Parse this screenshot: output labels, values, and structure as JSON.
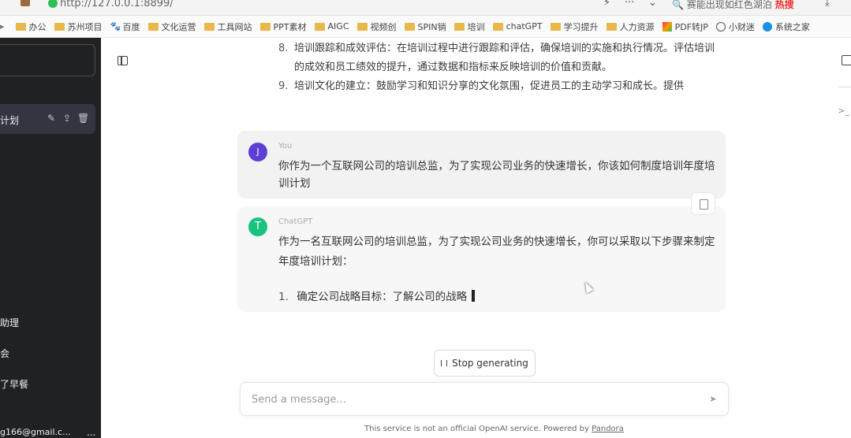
{
  "browser": {
    "url": "http://127.0.0.1:8899/",
    "search_text": "赛能出现如红色湖泊",
    "search_hot": "热搜"
  },
  "bookmarks": [
    {
      "label": "办公",
      "icon": "folder-icon"
    },
    {
      "label": "苏州项目",
      "icon": "folder-icon"
    },
    {
      "label": "百度",
      "icon": "paw-icon"
    },
    {
      "label": "文化运营",
      "icon": "folder-icon"
    },
    {
      "label": "工具网站",
      "icon": "folder-icon"
    },
    {
      "label": "PPT素材",
      "icon": "folder-icon"
    },
    {
      "label": "AIGC",
      "icon": "folder-icon"
    },
    {
      "label": "视频创",
      "icon": "folder-icon"
    },
    {
      "label": "SPIN销",
      "icon": "folder-icon"
    },
    {
      "label": "培训",
      "icon": "folder-icon"
    },
    {
      "label": "chatGPT",
      "icon": "folder-icon"
    },
    {
      "label": "学习提升",
      "icon": "folder-icon"
    },
    {
      "label": "人力资源",
      "icon": "folder-icon"
    },
    {
      "label": "PDF转JP",
      "icon": "pdf-icon"
    },
    {
      "label": "小财迷",
      "icon": "globe-icon"
    },
    {
      "label": "系统之家",
      "icon": "windows-icon"
    }
  ],
  "sidebar": {
    "conversation_label": "计划",
    "menu": [
      "助理",
      "会",
      "了早餐"
    ],
    "account_email": "g166@gmail.c...",
    "account_more": "..."
  },
  "previous_list": [
    {
      "num": "8.",
      "text": "培训跟踪和成效评估：在培训过程中进行跟踪和评估，确保培训的实施和执行情况。评估培训的成效和员工绩效的提升，通过数据和指标来反映培训的价值和贡献。"
    },
    {
      "num": "9.",
      "text": "培训文化的建立：鼓励学习和知识分享的文化氛围，促进员工的主动学习和成长。提供"
    }
  ],
  "user_message": {
    "avatar": "J",
    "sender": "You",
    "text": "你作为一个互联网公司的培训总监，为了实现公司业务的快速增长，你该如何制度培训年度培训计划"
  },
  "bot_message": {
    "avatar": "T",
    "sender": "ChatGPT",
    "text": "作为一名互联网公司的培训总监，为了实现公司业务的快速增长，你可以采取以下步骤来制定年度培训计划：",
    "list_num": "1.",
    "list_text": "确定公司战略目标：了解公司的战略"
  },
  "stop_button": "Stop generating",
  "composer": {
    "placeholder": "Send a message..."
  },
  "footer": {
    "text": "This service is not an official OpenAI service. Powered by",
    "link": "Pandora"
  }
}
